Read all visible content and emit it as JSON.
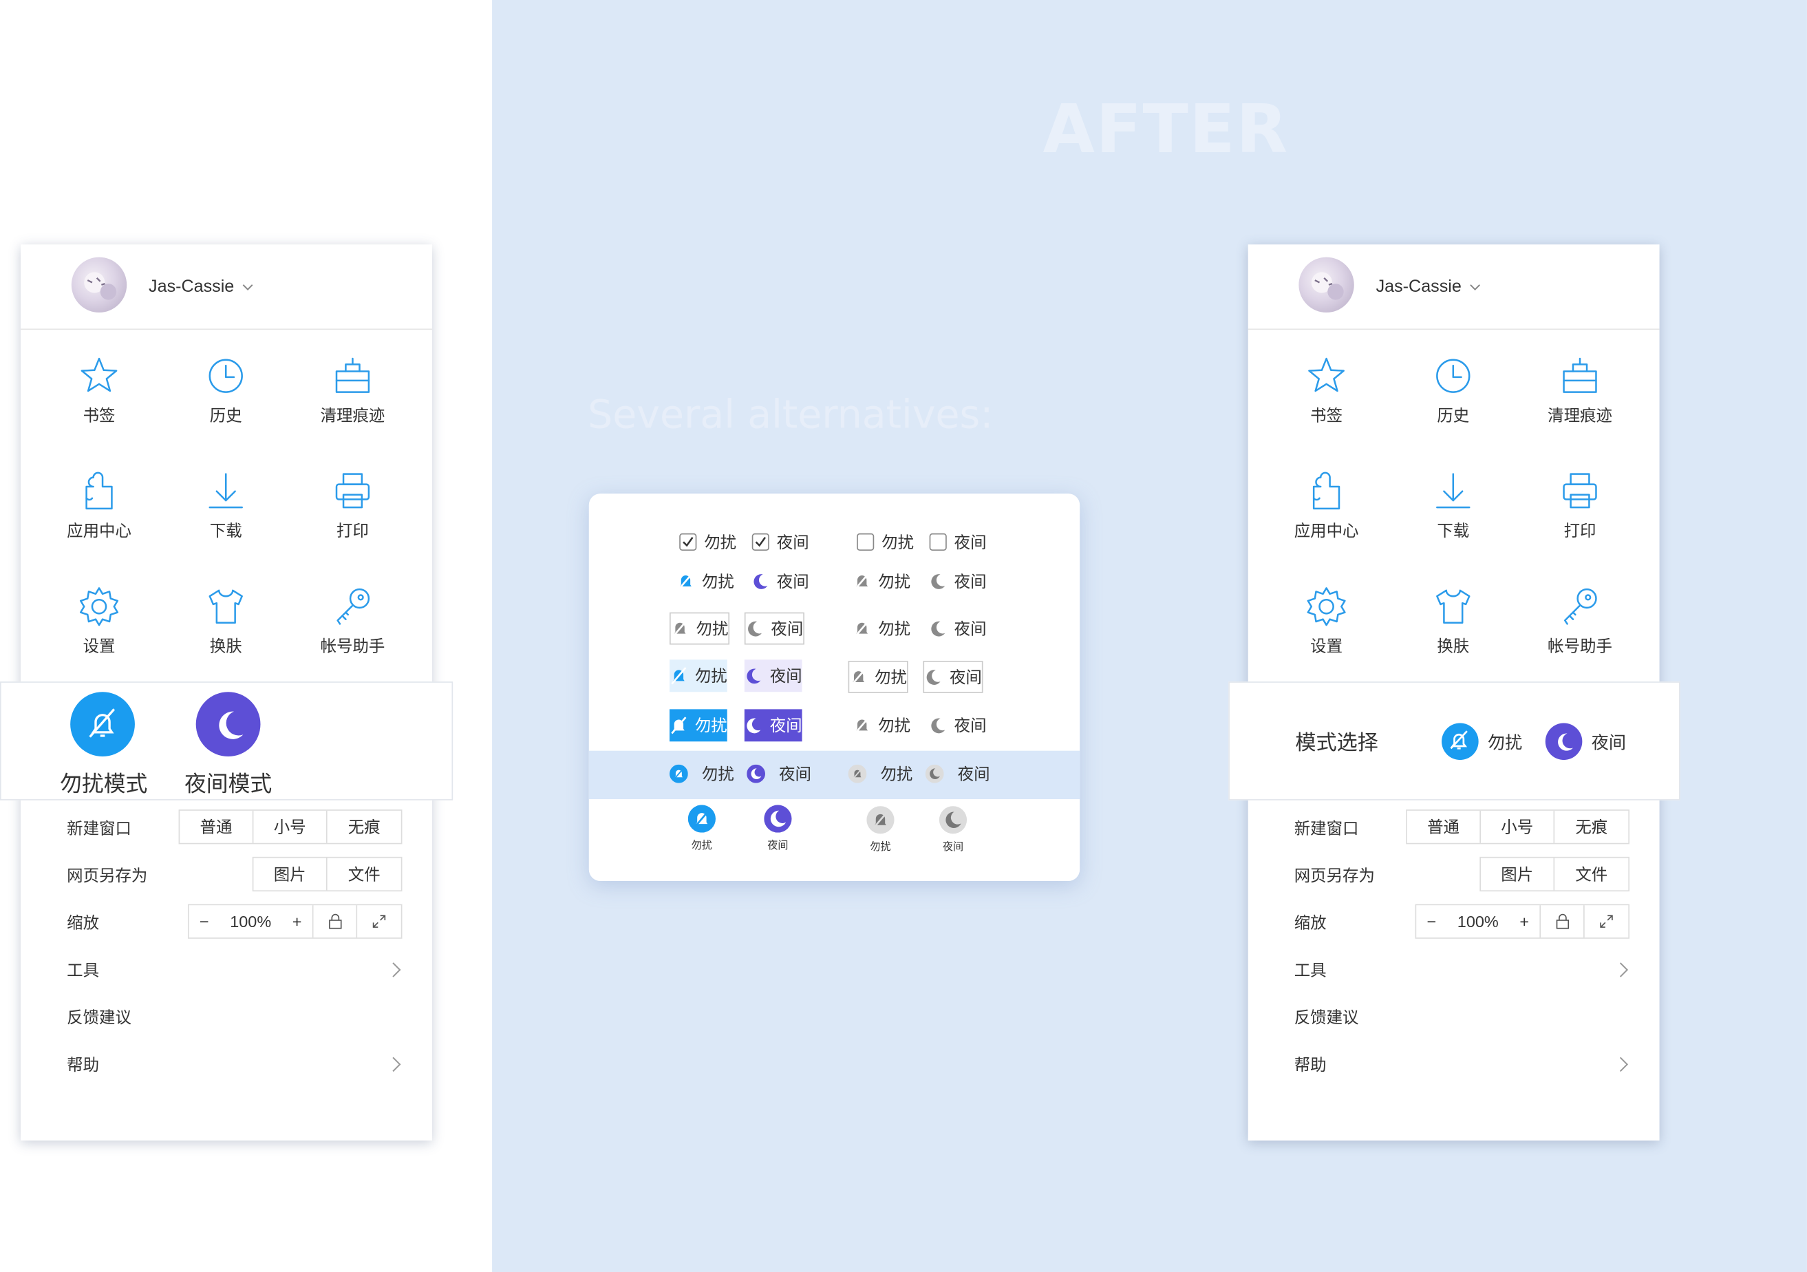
{
  "heading": {
    "after": "AFTER",
    "subtitle": "Several alternatives:"
  },
  "colors": {
    "blue": "#1a9cf0",
    "purple": "#5d4fd6",
    "grey": "#8a8a8a",
    "icon_blue": "#2b9bea",
    "bg": "#dce8f7"
  },
  "user": {
    "name": "Jas-Cassie"
  },
  "grid": [
    {
      "icon": "star-icon",
      "label": "书签"
    },
    {
      "icon": "clock-icon",
      "label": "历史"
    },
    {
      "icon": "broom-icon",
      "label": "清理痕迹"
    },
    {
      "icon": "puzzle-icon",
      "label": "应用中心"
    },
    {
      "icon": "download-icon",
      "label": "下载"
    },
    {
      "icon": "printer-icon",
      "label": "打印"
    },
    {
      "icon": "gear-icon",
      "label": "设置"
    },
    {
      "icon": "shirt-icon",
      "label": "换肤"
    },
    {
      "icon": "key-icon",
      "label": "帐号助手"
    }
  ],
  "modes": {
    "dnd": "勿扰",
    "night": "夜间",
    "dnd_full": "勿扰模式",
    "night_full": "夜间模式",
    "select_title": "模式选择"
  },
  "menu": {
    "new_window": "新建窗口",
    "new_window_opts": [
      "普通",
      "小号",
      "无痕"
    ],
    "save_as": "网页另存为",
    "save_as_opts": [
      "图片",
      "文件"
    ],
    "zoom": "缩放",
    "zoom_minus": "−",
    "zoom_value": "100%",
    "zoom_plus": "+",
    "tools": "工具",
    "feedback": "反馈建议",
    "help": "帮助"
  }
}
